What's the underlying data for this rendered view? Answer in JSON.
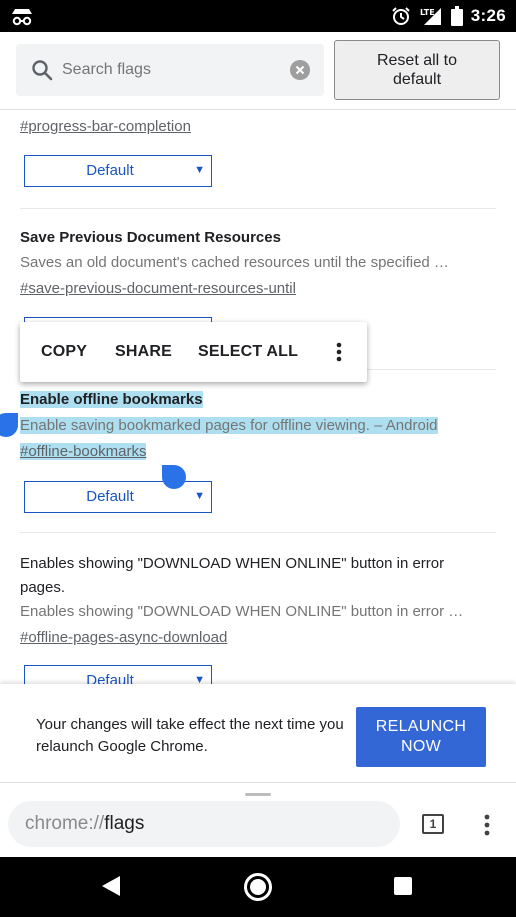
{
  "status_bar": {
    "time": "3:26",
    "network": "LTE",
    "icons": [
      "incognito-icon",
      "alarm-icon",
      "signal-icon",
      "battery-icon"
    ]
  },
  "header": {
    "search_placeholder": "Search flags",
    "reset_label": "Reset all to default"
  },
  "flags": [
    {
      "link": "#progress-bar-completion",
      "select_value": "Default"
    },
    {
      "title": "Save Previous Document Resources",
      "description": "Saves an old document's cached resources until the specified …",
      "link": "#save-previous-document-resources-until"
    },
    {
      "title": "Enable offline bookmarks",
      "description": "Enable saving bookmarked pages for offline viewing. – Android",
      "link": "#offline-bookmarks",
      "select_value": "Default"
    },
    {
      "title": "Enables showing \"DOWNLOAD WHEN ONLINE\" button in error pages.",
      "description": "Enables showing \"DOWNLOAD WHEN ONLINE\" button in error …",
      "link": "#offline-pages-async-download",
      "select_value": "Default"
    }
  ],
  "context_menu": {
    "copy": "COPY",
    "share": "SHARE",
    "select_all": "SELECT ALL"
  },
  "relaunch": {
    "message": "Your changes will take effect the next time you relaunch Google Chrome.",
    "button": "RELAUNCH NOW"
  },
  "toolbar": {
    "url_scheme": "chrome://",
    "url_host": "flags",
    "tab_count": "1"
  },
  "colors": {
    "accent": "#3367d6",
    "select_border": "#1a55c4",
    "selection_highlight": "#aedff0",
    "handle": "#2a72e8"
  }
}
